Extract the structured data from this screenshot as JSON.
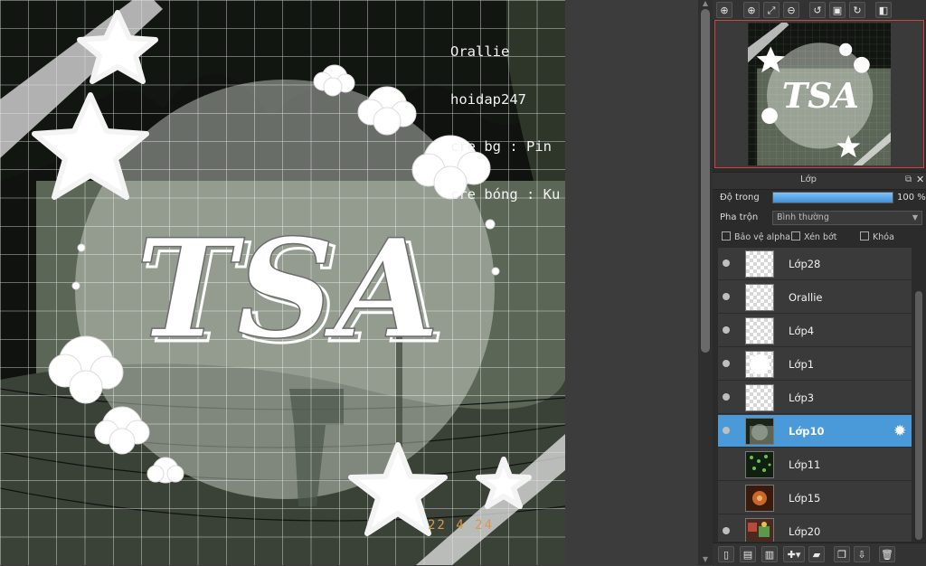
{
  "canvas": {
    "credit_lines": [
      "Orallie",
      "hoidap247",
      "cre bg : Pin",
      "cre bóng : Ku"
    ],
    "title_art": "TSA",
    "date_stamp": "22 4 24"
  },
  "navigator": {
    "tools": [
      "zoom-actual-icon",
      "zoom-in-icon",
      "fit-window-icon",
      "zoom-out-icon",
      "rotate-left-icon",
      "fit-canvas-icon",
      "rotate-right-icon",
      "flip-horizontal-icon"
    ]
  },
  "layer_panel": {
    "title": "Lớp",
    "opacity_label": "Độ trong",
    "opacity_value": "100 %",
    "opacity_percent": 100,
    "blend_label": "Pha trộn",
    "blend_value": "Bình thường",
    "protect_alpha": "Bảo vệ alpha",
    "clipping": "Xén bớt",
    "lock": "Khóa",
    "layers": [
      {
        "name": "Lớp28",
        "visible": true,
        "thumb": "transparent"
      },
      {
        "name": "Orallie",
        "visible": true,
        "thumb": "transparent"
      },
      {
        "name": "Lớp4",
        "visible": true,
        "thumb": "transparent"
      },
      {
        "name": "Lớp1",
        "visible": true,
        "thumb": "white-circle"
      },
      {
        "name": "Lớp3",
        "visible": true,
        "thumb": "transparent"
      },
      {
        "name": "Lớp10",
        "visible": true,
        "thumb": "photo-dark",
        "selected": true
      },
      {
        "name": "Lớp11",
        "visible": false,
        "thumb": "photo-green"
      },
      {
        "name": "Lớp15",
        "visible": false,
        "thumb": "photo-orange"
      },
      {
        "name": "Lớp20",
        "visible": true,
        "thumb": "photo-colorful"
      }
    ],
    "toolbar": [
      "new-layer-icon",
      "new-halftone-layer-icon",
      "new-8bit-layer-icon",
      "add-layer-menu-icon",
      "new-folder-icon",
      "duplicate-layer-icon",
      "merge-down-icon",
      "delete-layer-icon"
    ]
  },
  "colors": {
    "selected_layer": "#4a9ad9",
    "panel_bg": "#2b2b2b",
    "preview_border": "#cc4444"
  }
}
